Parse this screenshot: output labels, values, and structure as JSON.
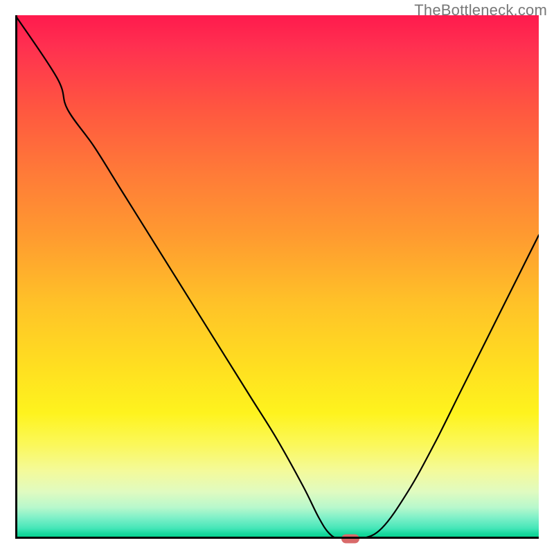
{
  "watermark": "TheBottleneck.com",
  "chart_data": {
    "type": "line",
    "title": "",
    "xlabel": "",
    "ylabel": "",
    "xlim": [
      0,
      100
    ],
    "ylim": [
      0,
      100
    ],
    "background_gradient": {
      "top_color": "#ff1a4d",
      "bottom_color": "#00cf8a",
      "description": "vertical red-to-green heat gradient"
    },
    "series": [
      {
        "name": "bottleneck-curve",
        "x": [
          0,
          8,
          10,
          15,
          20,
          25,
          30,
          35,
          40,
          45,
          50,
          55,
          58,
          60,
          62,
          66,
          70,
          75,
          80,
          85,
          90,
          95,
          100
        ],
        "values": [
          100,
          88,
          82,
          75,
          67,
          59,
          51,
          43,
          35,
          27,
          19,
          10,
          4,
          1,
          0,
          0,
          2,
          9,
          18,
          28,
          38,
          48,
          58
        ]
      }
    ],
    "marker": {
      "x": 64,
      "y": 0,
      "color": "#d96a6a"
    }
  }
}
